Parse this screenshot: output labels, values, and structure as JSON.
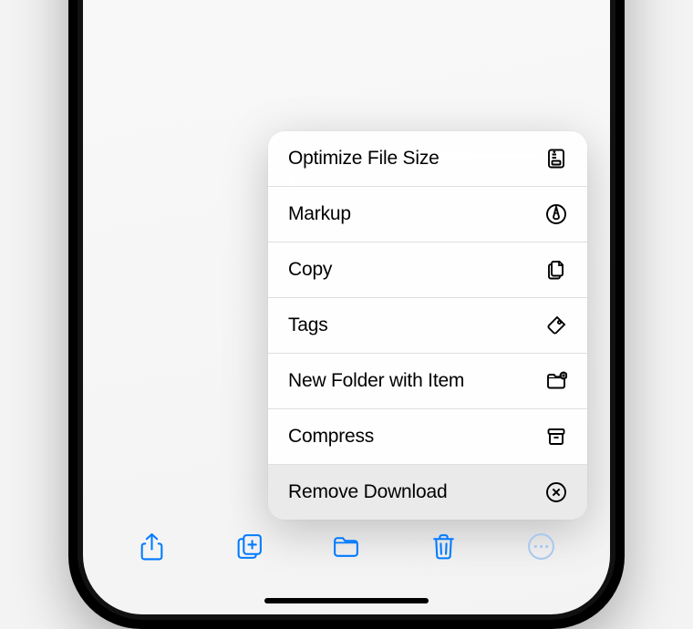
{
  "menu": {
    "items": [
      {
        "label": "Optimize File Size"
      },
      {
        "label": "Markup"
      },
      {
        "label": "Copy"
      },
      {
        "label": "Tags"
      },
      {
        "label": "New Folder with Item"
      },
      {
        "label": "Compress"
      },
      {
        "label": "Remove Download"
      }
    ]
  },
  "colors": {
    "accent": "#007aff"
  }
}
